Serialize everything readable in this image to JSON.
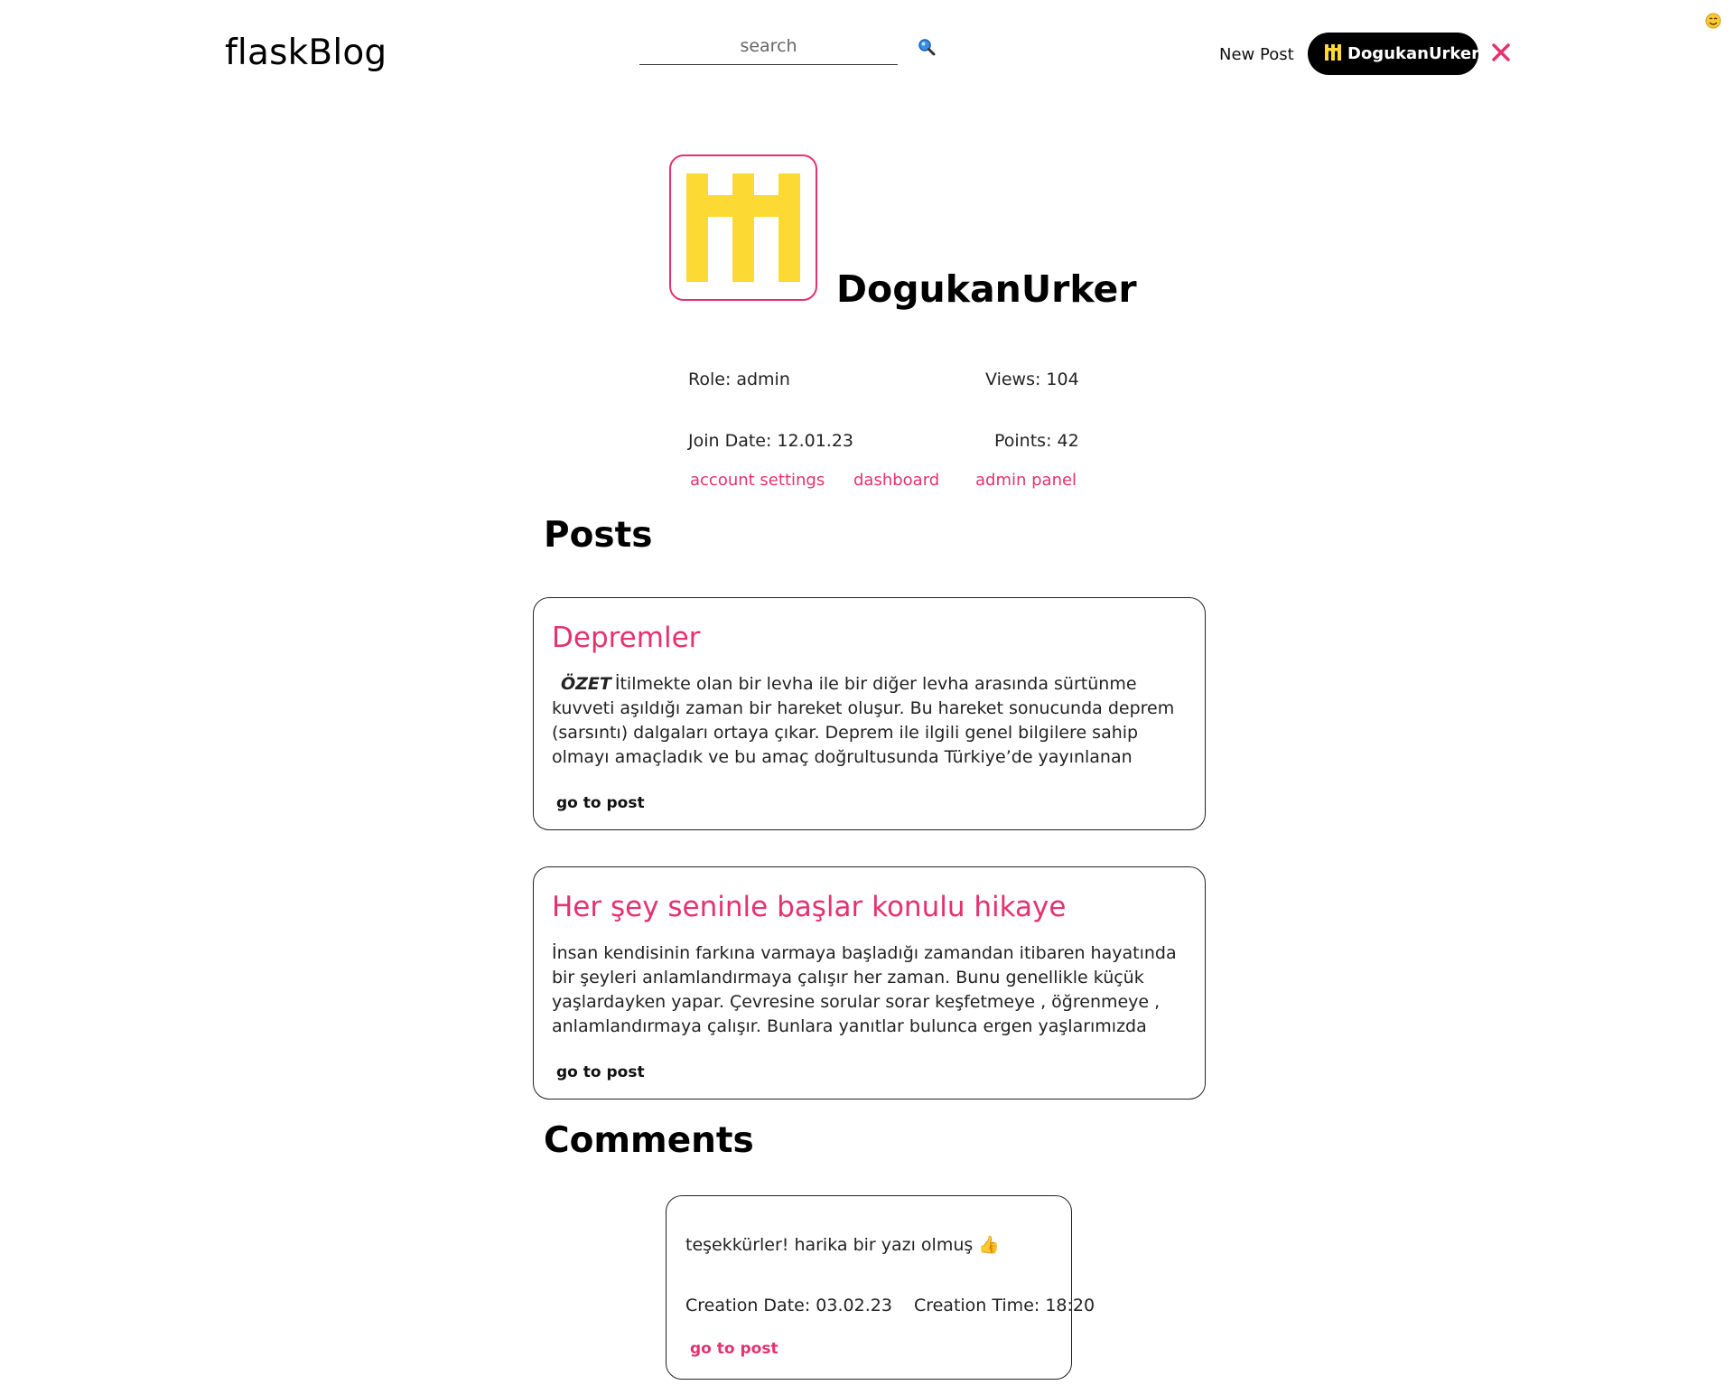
{
  "header": {
    "logo": "flaskBlog",
    "search_placeholder": "search",
    "new_post": "New Post",
    "username": "DogukanUrker"
  },
  "colors": {
    "accent": "#e6316f",
    "avatar_yellow": "#fcd933",
    "pill_bg": "#000000"
  },
  "profile": {
    "name": "DogukanUrker",
    "role_label": "Role:",
    "role_value": "admin",
    "views_label": "Views:",
    "views_value": "104",
    "join_label": "Join Date:",
    "join_value": "12.01.23",
    "points_label": "Points:",
    "points_value": "42",
    "links": [
      "account settings",
      "dashboard",
      "admin panel"
    ]
  },
  "posts_title": "Posts",
  "posts": [
    {
      "title": "Depremler",
      "lead": "ÖZET",
      "body": "İtilmekte olan bir levha ile bir diğer levha arasında sürtünme kuvveti aşıldığı zaman bir hareket oluşur. Bu hareket sonucunda deprem (sarsıntı) dalgaları ortaya çıkar. Deprem ile ilgili genel bilgilere sahip olmayı amaçladık ve bu amaç doğrultusunda Türkiye’de yayınlanan makale ve diğer araştırmalar...",
      "link": "go to post"
    },
    {
      "title": "Her şey seninle başlar konulu hikaye",
      "lead": "",
      "body": "İnsan kendisinin farkına varmaya başladığı zamandan itibaren hayatında bir şeyleri anlamlandırmaya çalışır her zaman. Bunu genellikle küçük yaşlardayken yapar. Çevresine sorular sorar keşfetmeye , öğrenmeye , anlamlandırmaya çalışır. Bunlara yanıtlar bulunca ergen yaşlarımızda olaylar ve kişiler hakkında...",
      "link": "go to post"
    }
  ],
  "comments_title": "Comments",
  "comments": [
    {
      "text": "teşekkürler! harika bir yazı olmuş 👍",
      "date_label": "Creation Date:",
      "date_value": "03.02.23",
      "time_label": "Creation Time:",
      "time_value": "18:20",
      "link": "go to post"
    }
  ],
  "icons": [
    "search-icon",
    "user-avatar-icon",
    "close-icon",
    "smiley-icon"
  ]
}
